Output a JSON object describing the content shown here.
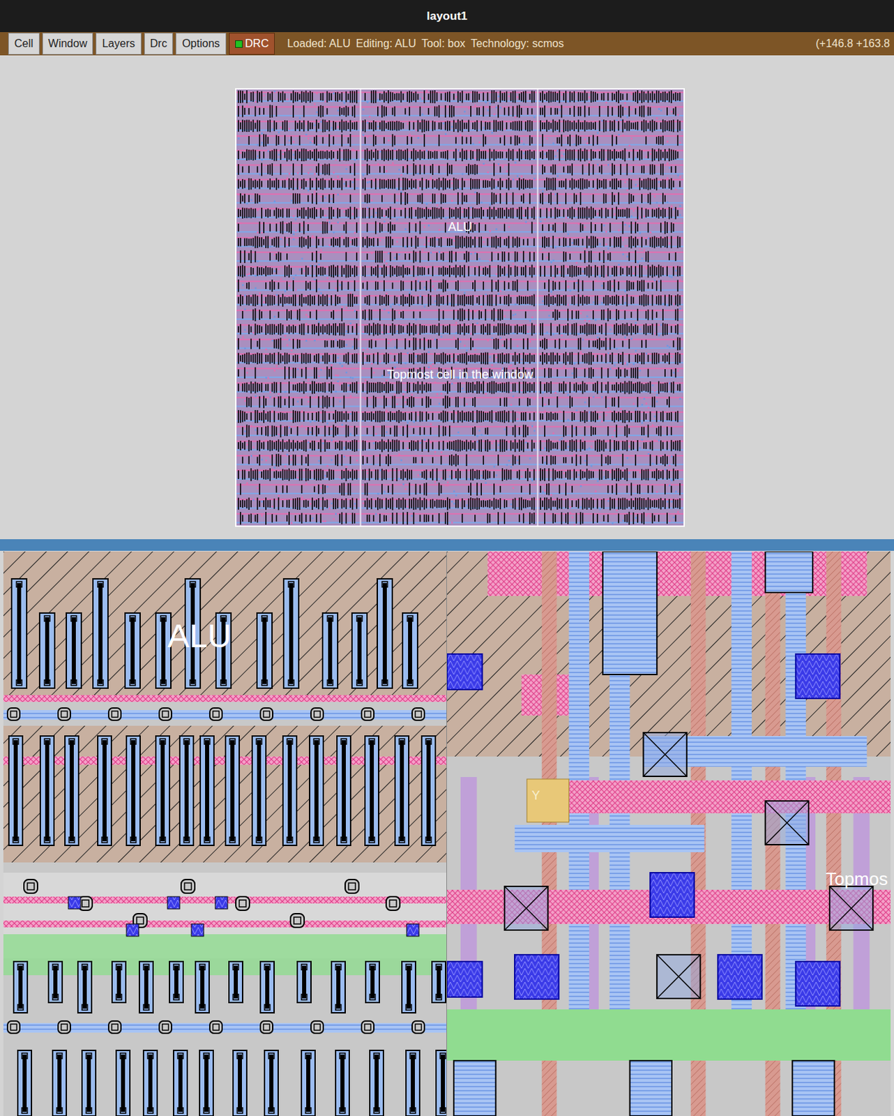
{
  "window": {
    "title": "layout1"
  },
  "menu": [
    {
      "label": "Cell"
    },
    {
      "label": "Window"
    },
    {
      "label": "Layers"
    },
    {
      "label": "Drc"
    },
    {
      "label": "Options"
    }
  ],
  "drc_indicator": {
    "label": "DRC",
    "ok": true
  },
  "status": {
    "loaded": "Loaded: ALU",
    "editing": "Editing: ALU",
    "tool": "Tool: box",
    "technology": "Technology: scmos",
    "coordinates": "(+146.8 +163.8"
  },
  "top_view": {
    "cell_label": "ALU",
    "window_label": "Topmost cell in the window"
  },
  "bottom_left_view": {
    "cell_label": "ALU"
  },
  "bottom_right_view": {
    "window_label": "Topmos",
    "node_label": "Y"
  }
}
